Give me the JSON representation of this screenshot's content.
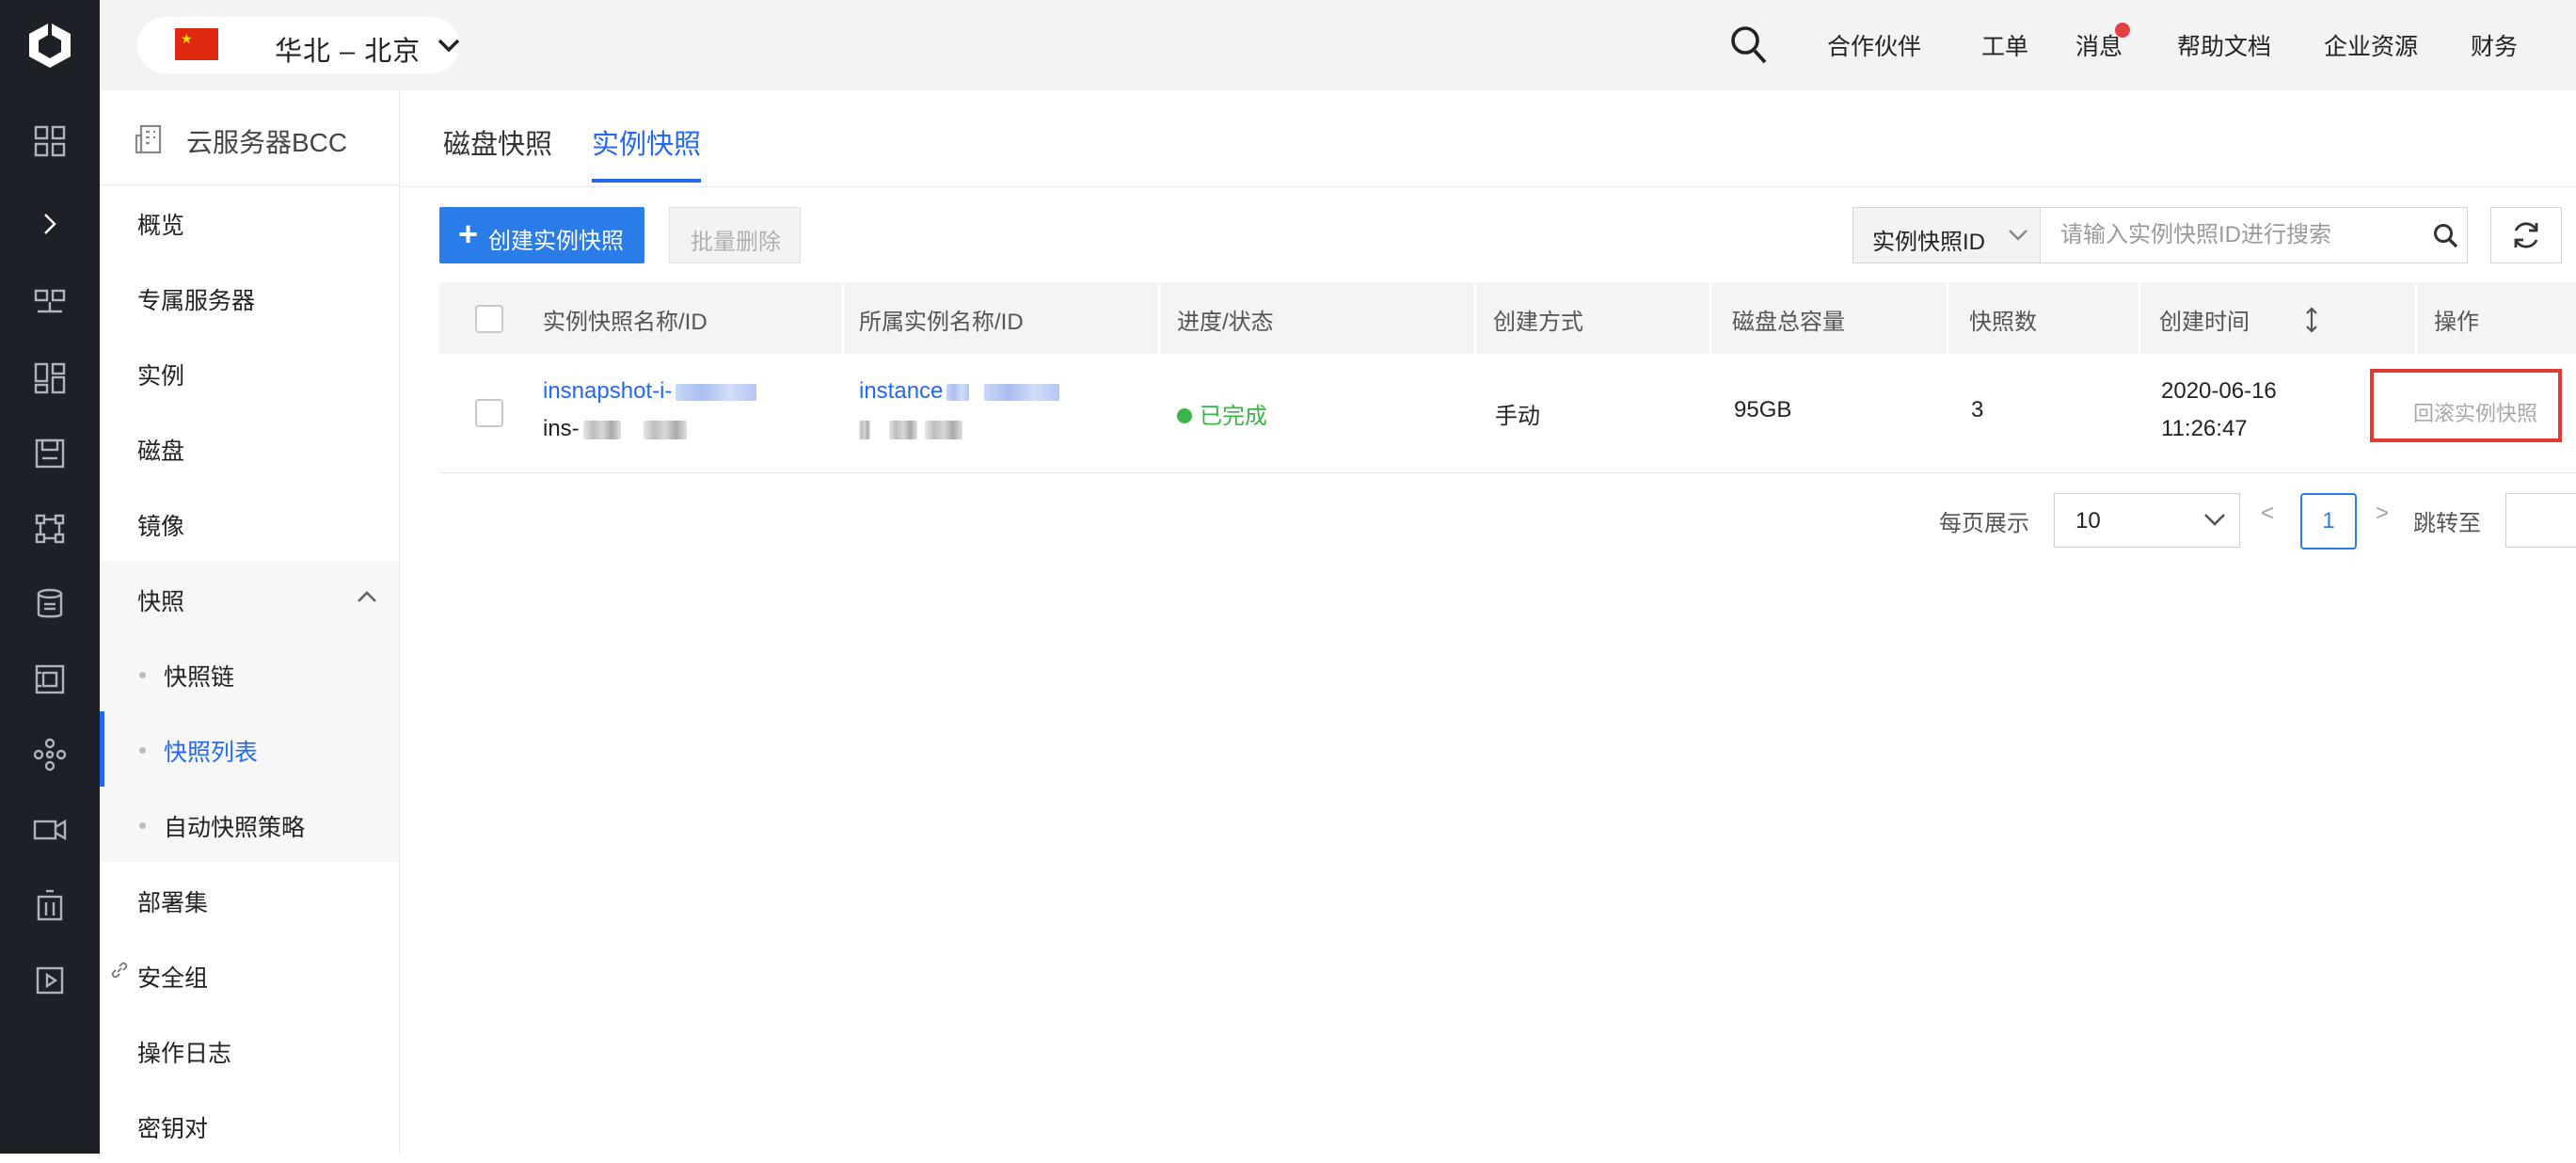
{
  "topbar": {
    "region": "华北 – 北京",
    "nav": [
      "合作伙伴",
      "工单",
      "消息",
      "帮助文档",
      "企业资源",
      "财务"
    ]
  },
  "menu": {
    "title": "云服务器BCC",
    "items": [
      "概览",
      "专属服务器",
      "实例",
      "磁盘",
      "镜像",
      "快照"
    ],
    "sub_items": [
      "快照链",
      "快照列表",
      "自动快照策略"
    ],
    "items_after": [
      "部署集",
      "安全组",
      "操作日志",
      "密钥对"
    ]
  },
  "tabs": [
    "磁盘快照",
    "实例快照"
  ],
  "toolbar": {
    "create_label": "创建实例快照",
    "batch_delete_label": "批量删除",
    "search_field": "实例快照ID",
    "search_placeholder": "请输入实例快照ID进行搜索"
  },
  "table": {
    "headers": [
      "实例快照名称/ID",
      "所属实例名称/ID",
      "进度/状态",
      "创建方式",
      "磁盘总容量",
      "快照数",
      "创建时间",
      "操作"
    ],
    "rows": [
      {
        "snapshot_name": "insnapshot-i-",
        "snapshot_id": "ins-",
        "instance_name": "instance",
        "status": "已完成",
        "create_method": "手动",
        "disk_size": "95GB",
        "snapshot_count": "3",
        "created_date": "2020-06-16",
        "created_time": "11:26:47",
        "action": "回滚实例快照"
      }
    ]
  },
  "pager": {
    "per_page_label": "每页展示",
    "per_page_value": "10",
    "prev": "<",
    "current": "1",
    "next": ">",
    "jump_label": "跳转至"
  },
  "colors": {
    "primary": "#2a7ce8",
    "link": "#2468f2",
    "success": "#3bb54a",
    "highlight_box": "#e03a31",
    "rail": "#1e2027"
  }
}
